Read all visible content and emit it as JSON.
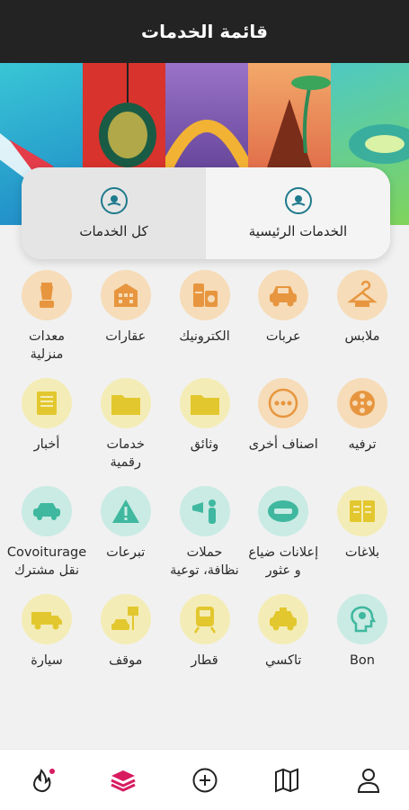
{
  "header": {
    "title": "قائمة الخدمات"
  },
  "tabs": [
    {
      "label": "الخدمات الرئيسية",
      "active": true
    },
    {
      "label": "كل الخدمات",
      "active": false
    }
  ],
  "services": [
    [
      {
        "label": "ملابس",
        "icon": "hanger-icon",
        "color": "orange"
      },
      {
        "label": "عربات",
        "icon": "car-icon",
        "color": "orange"
      },
      {
        "label": "الكترونيك",
        "icon": "appliances-icon",
        "color": "orange"
      },
      {
        "label": "عقارات",
        "icon": "building-icon",
        "color": "orange"
      },
      {
        "label": "معدات منزلية",
        "icon": "blender-icon",
        "color": "orange"
      }
    ],
    [
      {
        "label": "ترفيه",
        "icon": "film-reel-icon",
        "color": "yellow"
      },
      {
        "label": "اصناف أخرى",
        "icon": "more-dots-icon",
        "color": "yellow"
      },
      {
        "label": "وثائق",
        "icon": "folder-icon",
        "color": "yellow"
      },
      {
        "label": "خدمات رقمية",
        "icon": "folder-icon",
        "color": "yellow"
      },
      {
        "label": "أخبار",
        "icon": "newspaper-icon",
        "color": "yellow"
      }
    ],
    [
      {
        "label": "بلاغات",
        "icon": "report-book-icon",
        "color": "yellow"
      },
      {
        "label": "إعلانات ضياع و عثور",
        "icon": "lost-found-icon",
        "color": "teal"
      },
      {
        "label": "حملات نظافة، توعية",
        "icon": "megaphone-icon",
        "color": "teal"
      },
      {
        "label": "تبرعات",
        "icon": "warning-icon",
        "color": "teal"
      },
      {
        "label": "Covoiturage نقل مشترك",
        "icon": "carpool-icon",
        "color": "teal"
      }
    ],
    [
      {
        "label": "Bon",
        "icon": "idea-head-icon",
        "color": "teal"
      },
      {
        "label": "تاكسي",
        "icon": "taxi-icon",
        "color": "yellow"
      },
      {
        "label": "قطار",
        "icon": "train-icon",
        "color": "yellow"
      },
      {
        "label": "موقف",
        "icon": "parking-icon",
        "color": "yellow"
      },
      {
        "label": "سيارة",
        "icon": "truck-icon",
        "color": "yellow"
      }
    ]
  ],
  "nav": [
    {
      "icon": "profile-icon"
    },
    {
      "icon": "map-icon"
    },
    {
      "icon": "add-icon"
    },
    {
      "icon": "layers-icon",
      "active": true
    },
    {
      "icon": "flame-icon",
      "badge": true
    }
  ],
  "colors": {
    "accent": "#d81b60",
    "icon_orange": "#e7963f",
    "icon_yellow": "#e3c72e",
    "icon_teal": "#3fb89f"
  }
}
